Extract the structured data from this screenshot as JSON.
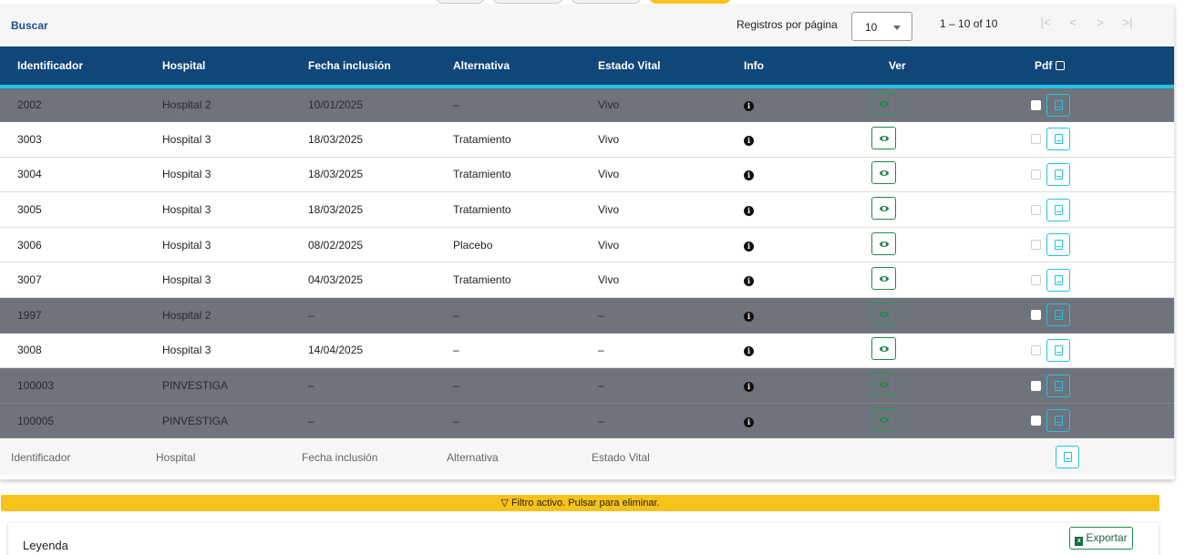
{
  "toolbar": {
    "search_label": "Buscar",
    "rows_per_page_label": "Registros por página",
    "rows_per_page_value": "10",
    "range_text": "1 – 10 of 10",
    "first_icon": "|<",
    "prev_icon": "<",
    "next_icon": ">",
    "last_icon": ">|"
  },
  "table": {
    "columns": [
      "Identificador",
      "Hospital",
      "Fecha inclusión",
      "Alternativa",
      "Estado Vital",
      "Info",
      "Ver",
      "Pdf"
    ],
    "rows": [
      {
        "id": "2002",
        "hospital": "Hospital 2",
        "fecha": "10/01/2025",
        "alternativa": "–",
        "estado": "Vivo",
        "disabled": true
      },
      {
        "id": "3003",
        "hospital": "Hospital 3",
        "fecha": "18/03/2025",
        "alternativa": "Tratamiento",
        "estado": "Vivo",
        "disabled": false
      },
      {
        "id": "3004",
        "hospital": "Hospital 3",
        "fecha": "18/03/2025",
        "alternativa": "Tratamiento",
        "estado": "Vivo",
        "disabled": false
      },
      {
        "id": "3005",
        "hospital": "Hospital 3",
        "fecha": "18/03/2025",
        "alternativa": "Tratamiento",
        "estado": "Vivo",
        "disabled": false
      },
      {
        "id": "3006",
        "hospital": "Hospital 3",
        "fecha": "08/02/2025",
        "alternativa": "Placebo",
        "estado": "Vivo",
        "disabled": false
      },
      {
        "id": "3007",
        "hospital": "Hospital 3",
        "fecha": "04/03/2025",
        "alternativa": "Tratamiento",
        "estado": "Vivo",
        "disabled": false
      },
      {
        "id": "1997",
        "hospital": "Hospital 2",
        "fecha": "–",
        "alternativa": "–",
        "estado": "–",
        "disabled": true
      },
      {
        "id": "3008",
        "hospital": "Hospital 3",
        "fecha": "14/04/2025",
        "alternativa": "–",
        "estado": "–",
        "disabled": false
      },
      {
        "id": "100003",
        "hospital": "PINVESTIGA",
        "fecha": "–",
        "alternativa": "–",
        "estado": "–",
        "disabled": true
      },
      {
        "id": "100005",
        "hospital": "PINVESTIGA",
        "fecha": "–",
        "alternativa": "–",
        "estado": "–",
        "disabled": true
      }
    ],
    "filter_row": [
      "Identificador",
      "Hospital",
      "Fecha inclusión",
      "Alternativa",
      "Estado Vital"
    ],
    "info_icon": "info-circle-icon",
    "view_icon": "eye-icon",
    "pdf_icon": "pdf-file-icon"
  },
  "filter_banner": "Filtro activo. Pulsar para eliminar.",
  "legend": {
    "title": "Leyenda",
    "export_label": "Exportar"
  },
  "colors": {
    "header_bg": "#114679",
    "header_accent": "#23c3e6",
    "disabled_row": "#6e737c",
    "banner": "#f8c21c",
    "view_green": "#1b8a4b"
  }
}
